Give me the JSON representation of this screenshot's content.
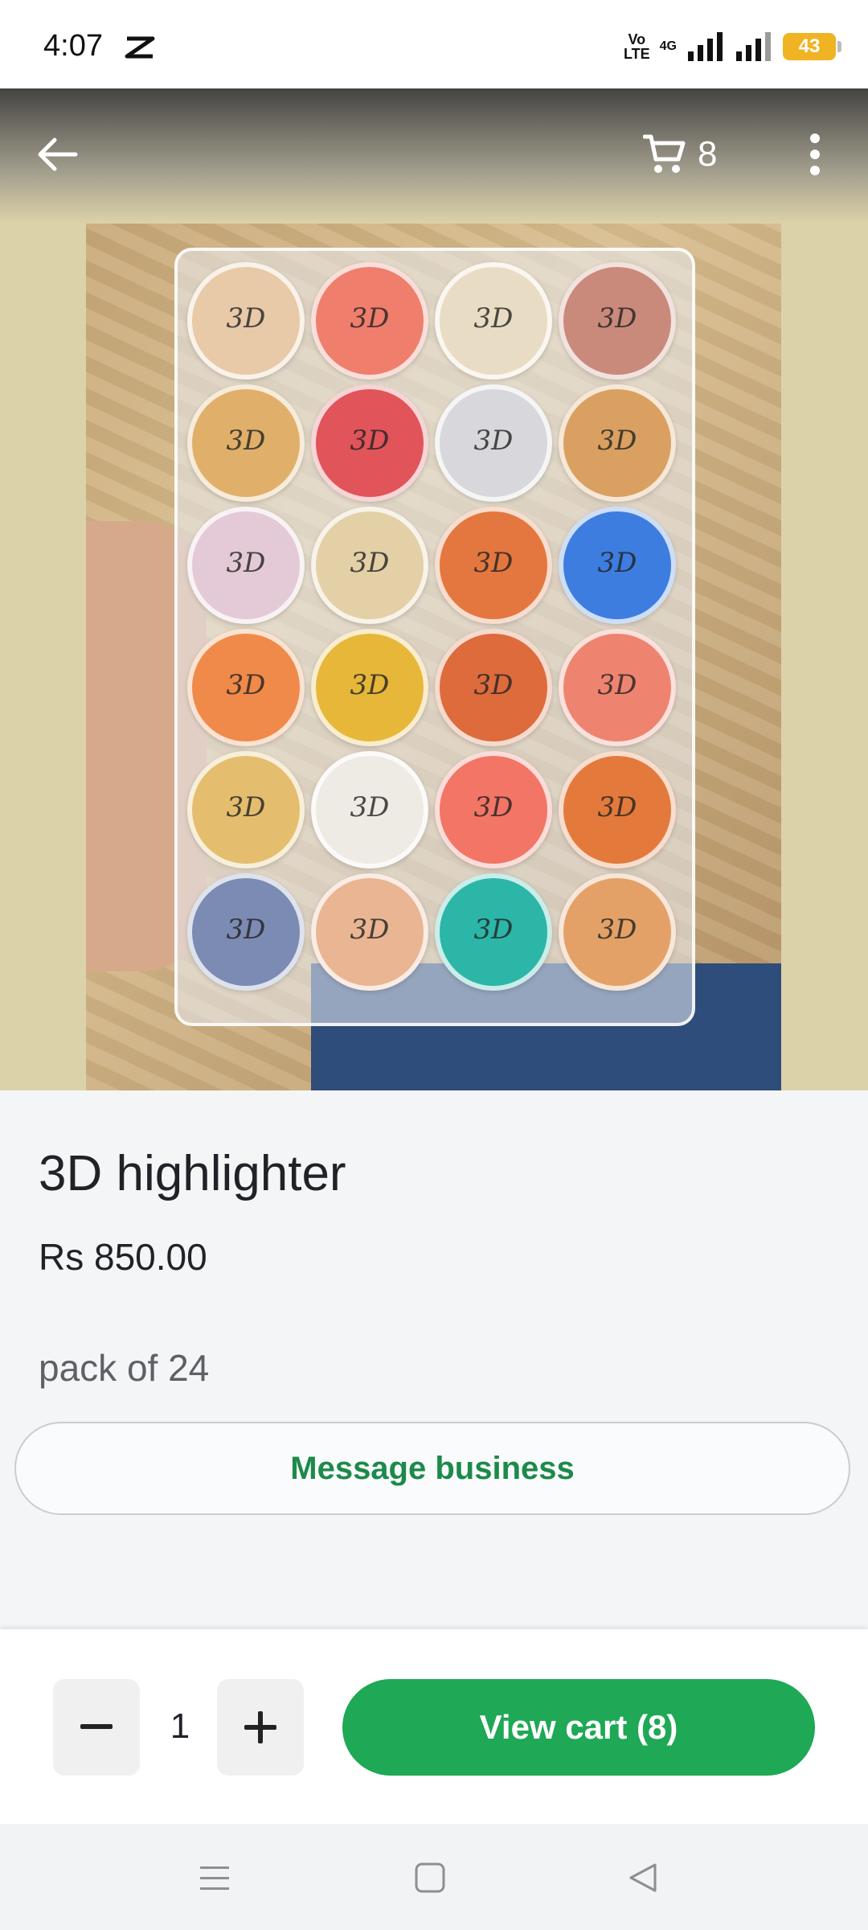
{
  "status_bar": {
    "time": "4:07",
    "volte": "Vo\nLTE",
    "network": "4G",
    "battery": "43"
  },
  "header": {
    "cart_count": "8"
  },
  "product": {
    "title": "3D highlighter",
    "price": "Rs 850.00",
    "description": "pack of 24",
    "image_jar_text": "3D"
  },
  "actions": {
    "message_business": "Message business",
    "quantity": "1",
    "view_cart": "View cart (8)"
  },
  "colors": {
    "accent_green": "#1fa855",
    "link_green": "#1c8a4a",
    "battery": "#f0b323"
  },
  "icons": {
    "back": "arrow-left-icon",
    "cart": "shopping-cart-icon",
    "more": "more-vertical-icon",
    "minus": "minus-icon",
    "plus": "plus-icon"
  }
}
